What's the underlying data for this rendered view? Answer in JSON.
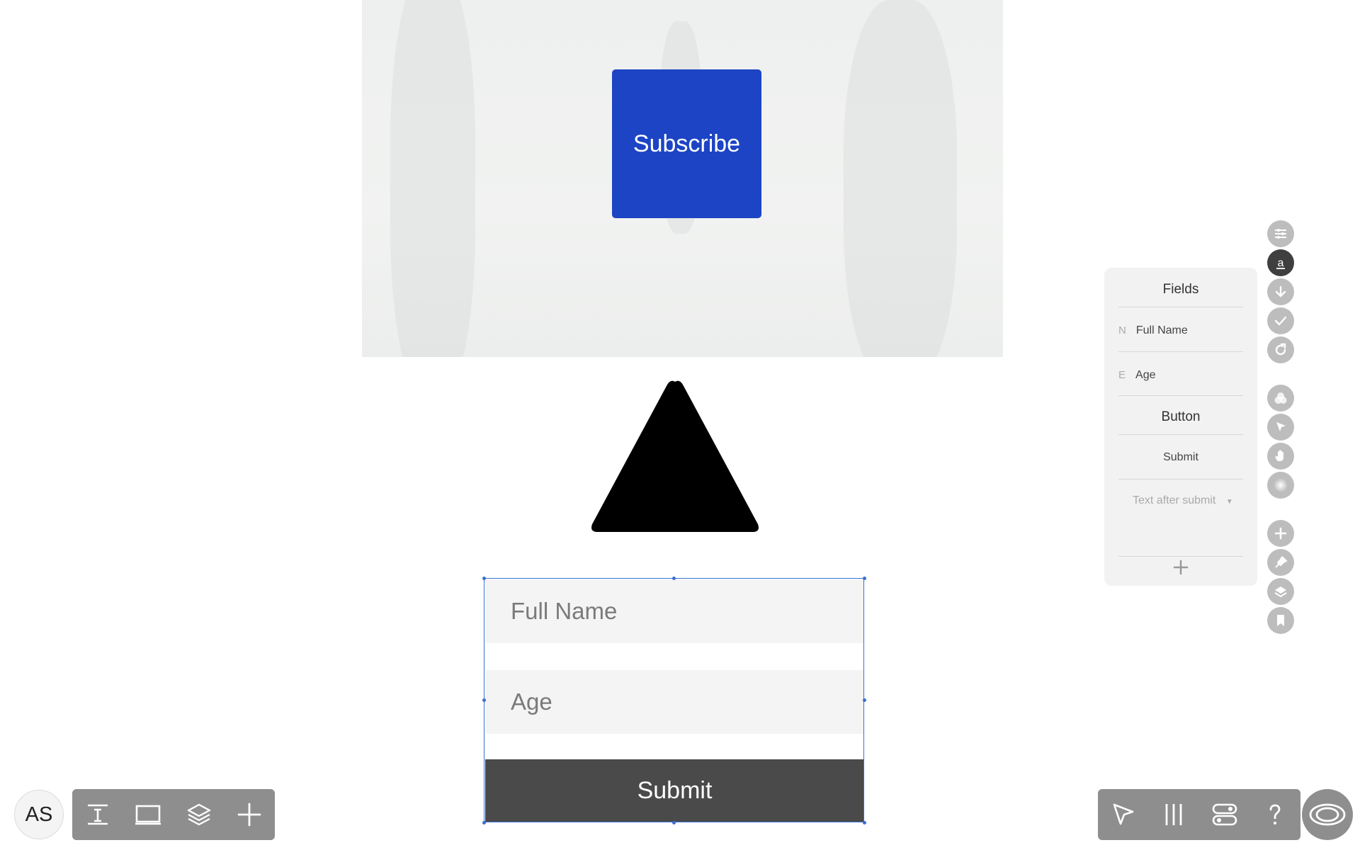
{
  "canvas": {
    "hero_button_label": "Subscribe",
    "form": {
      "fields": [
        {
          "placeholder": "Full Name"
        },
        {
          "placeholder": "Age"
        }
      ],
      "submit_label": "Submit"
    }
  },
  "fields_panel": {
    "fields_heading": "Fields",
    "fields": [
      {
        "key": "N",
        "label": "Full Name"
      },
      {
        "key": "E",
        "label": "Age"
      }
    ],
    "button_heading": "Button",
    "button_label": "Submit",
    "after_submit_placeholder": "Text after submit"
  },
  "right_rail": {
    "icons": [
      "sliders-icon",
      "text-style-icon",
      "arrow-down-icon",
      "check-icon",
      "redo-icon",
      "blend-icon",
      "cursor-icon",
      "hand-icon",
      "gradient-icon",
      "plus-icon",
      "pin-icon",
      "layers-icon",
      "bookmark-icon"
    ]
  },
  "bottom_left": {
    "avatar_initials": "AS",
    "tools": [
      "text-tool-icon",
      "frame-tool-icon",
      "layers-icon",
      "add-icon"
    ]
  },
  "bottom_right": {
    "tools": [
      "pointer-icon",
      "columns-icon",
      "toggle-icon",
      "help-icon"
    ],
    "preview": "eye-icon"
  },
  "colors": {
    "subscribe_button": "#1c44c4",
    "submit_button": "#4a4a4a",
    "selection": "#3b6fd0",
    "toolbar": "#8e8e8e"
  }
}
